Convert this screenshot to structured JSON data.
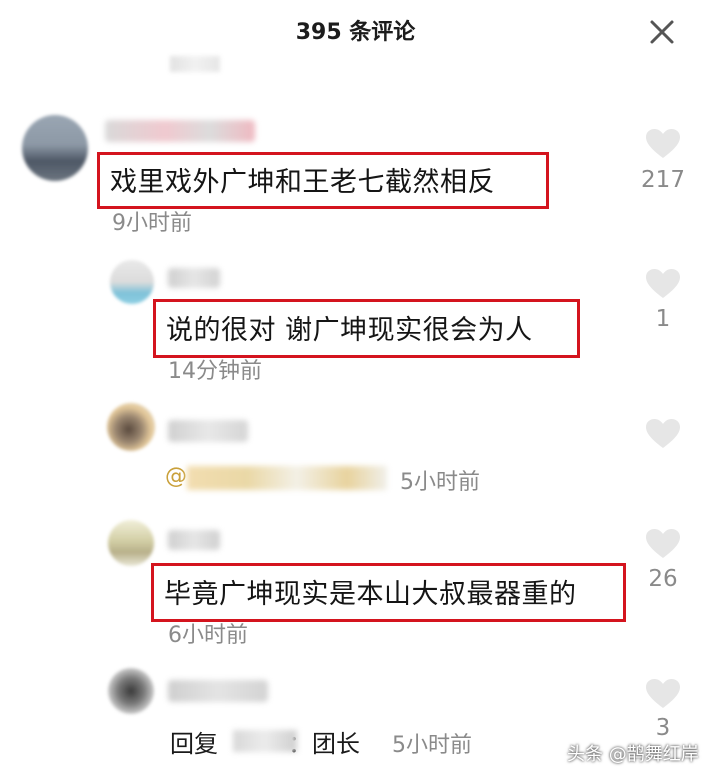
{
  "header": {
    "title": "395 条评论",
    "close_icon": "close-icon"
  },
  "comments": [
    {
      "text": "戏里戏外广坤和王老七截然相反",
      "time": "9小时前",
      "likes": "217"
    },
    {
      "text": "说的很对 谢广坤现实很会为人",
      "time": "14分钟前",
      "likes": "1"
    },
    {
      "mention_prefix": "@",
      "time": "5小时前",
      "likes": ""
    },
    {
      "text": "毕竟广坤现实是本山大叔最器重的",
      "time": "6小时前",
      "likes": "26"
    },
    {
      "reply_prefix": "回复",
      "reply_text": "：团长",
      "time": "5小时前",
      "likes": "3"
    }
  ],
  "watermark": "头条 @鹊舞红岸",
  "colors": {
    "highlight": "#d4141e",
    "meta": "#8a8a8a",
    "mention": "#c9a03a"
  }
}
